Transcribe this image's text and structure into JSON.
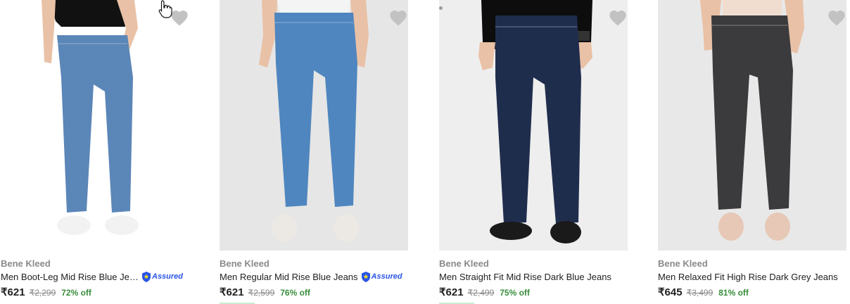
{
  "products": [
    {
      "brand": "Bene Kleed",
      "title": "Men Boot-Leg Mid Rise Blue Jea...",
      "assured": "Assured",
      "price": "₹621",
      "mrp": "₹2,299",
      "discount": "72% off",
      "jeans_color": "#5b86b8",
      "top_color": "#111111",
      "shoe_color": "#f2f2f2",
      "bg_color": "#ffffff"
    },
    {
      "brand": "Bene Kleed",
      "title": "Men Regular Mid Rise Blue Jeans",
      "assured": "Assured",
      "price": "₹621",
      "mrp": "₹2,599",
      "discount": "76% off",
      "jeans_color": "#4f86bf",
      "top_color": "#f4f4f4",
      "shoe_color": "#ece9e4",
      "bg_color": "#e6e6e6"
    },
    {
      "brand": "Bene Kleed",
      "title": "Men Straight Fit Mid Rise Dark Blue Jeans",
      "assured": "",
      "price": "₹621",
      "mrp": "₹2,499",
      "discount": "75% off",
      "jeans_color": "#1f2d4d",
      "top_color": "#0d0d0d",
      "shoe_color": "#1a1a1a",
      "bg_color": "#eeeeee"
    },
    {
      "brand": "Bene Kleed",
      "title": "Men Relaxed Fit High Rise Dark Grey Jeans",
      "assured": "",
      "price": "₹645",
      "mrp": "₹3,499",
      "discount": "81% off",
      "jeans_color": "#3b3b3e",
      "top_color": "#f1ddd0",
      "shoe_color": "#e7c8b6",
      "bg_color": "#e8e8e8"
    }
  ],
  "colors": {
    "discount_green": "#388e3c",
    "assured_blue": "#2a55e5",
    "wishlist_heart": "#c2c2c2"
  }
}
